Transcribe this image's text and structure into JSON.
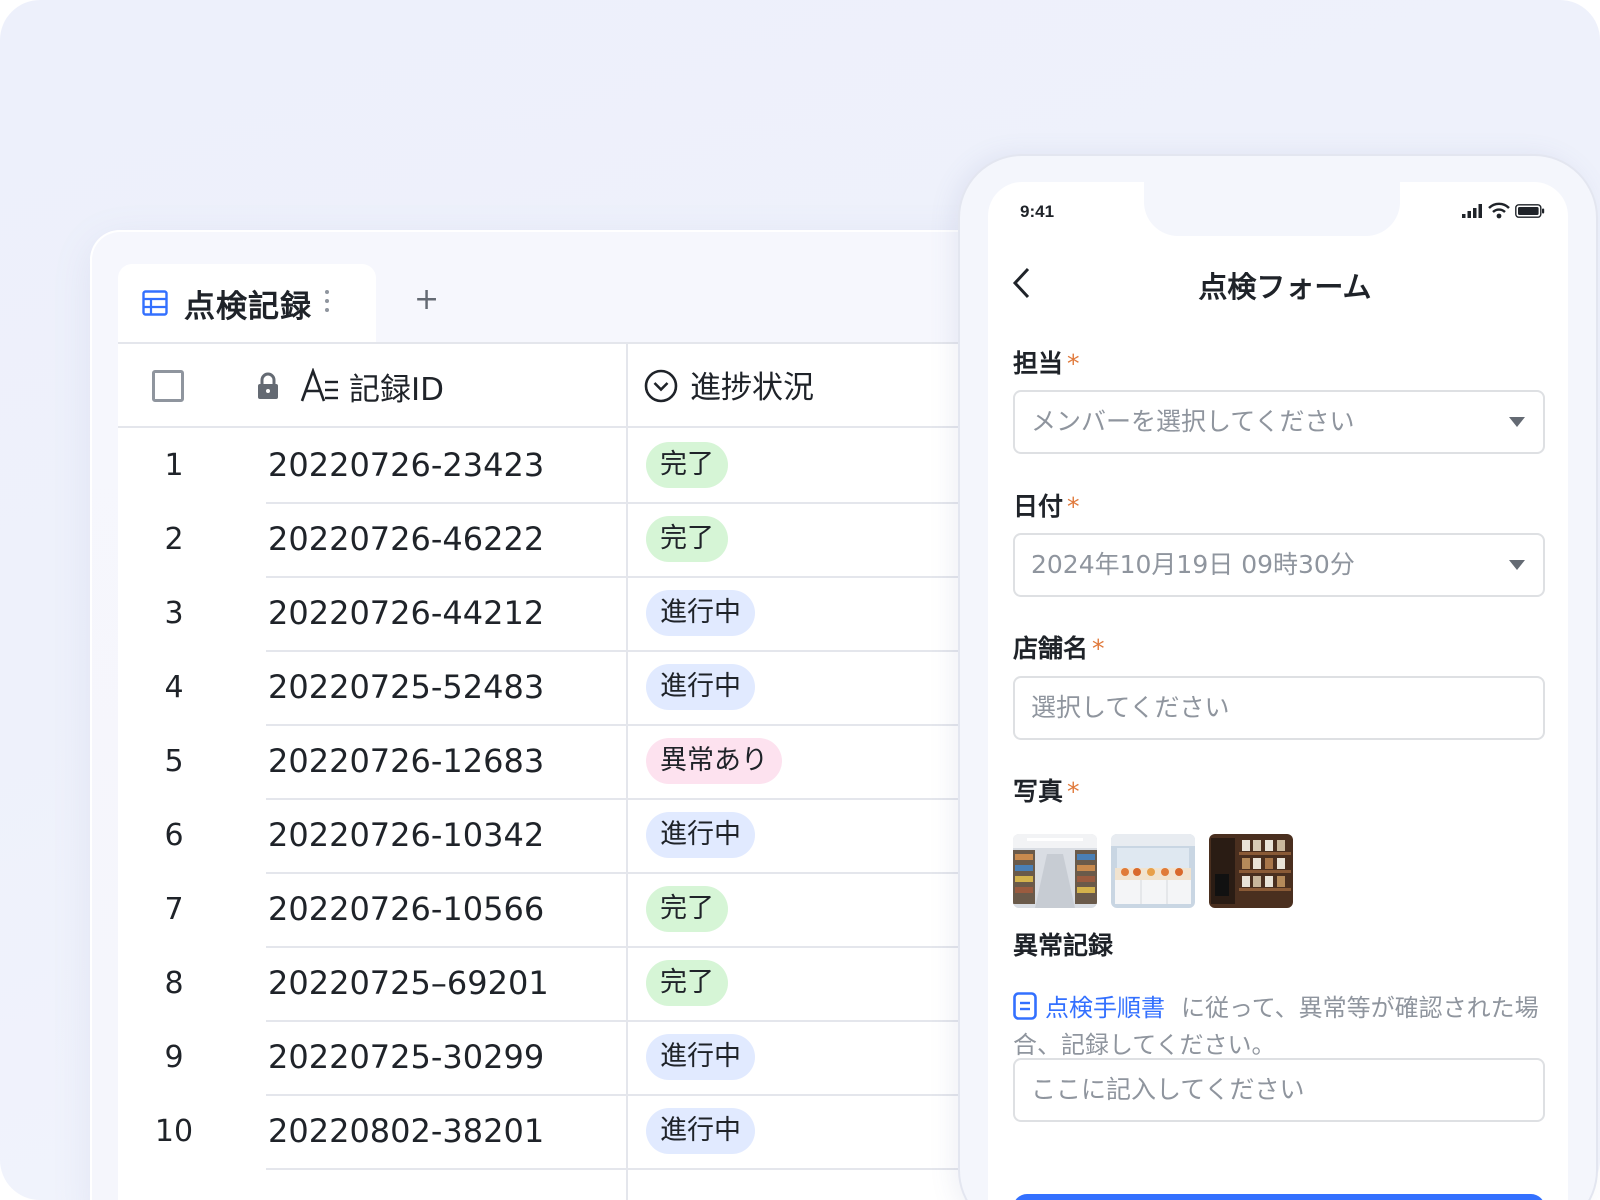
{
  "table": {
    "tab_label": "点検記録",
    "add_tab": "+",
    "headers": {
      "record_id": "記録ID",
      "status": "進捗状況"
    },
    "rows": [
      {
        "num": "1",
        "id": "20220726-23423",
        "status": "完了",
        "tone": "done"
      },
      {
        "num": "2",
        "id": "20220726-46222",
        "status": "完了",
        "tone": "done"
      },
      {
        "num": "3",
        "id": "20220726-44212",
        "status": "進行中",
        "tone": "progress"
      },
      {
        "num": "4",
        "id": "20220725-52483",
        "status": "進行中",
        "tone": "progress"
      },
      {
        "num": "5",
        "id": "20220726-12683",
        "status": "異常あり",
        "tone": "alert"
      },
      {
        "num": "6",
        "id": "20220726-10342",
        "status": "進行中",
        "tone": "progress"
      },
      {
        "num": "7",
        "id": "20220726-10566",
        "status": "完了",
        "tone": "done"
      },
      {
        "num": "8",
        "id": "20220725–69201",
        "status": "完了",
        "tone": "done"
      },
      {
        "num": "9",
        "id": "20220725-30299",
        "status": "進行中",
        "tone": "progress"
      },
      {
        "num": "10",
        "id": "20220802-38201",
        "status": "進行中",
        "tone": "progress"
      }
    ]
  },
  "status_colors": {
    "done": "#d6f5d6",
    "progress": "#e1eaff",
    "alert": "#fde2ef"
  },
  "phone": {
    "time": "9:41",
    "title": "点検フォーム",
    "fields": {
      "assignee": {
        "label": "担当",
        "required": "*",
        "placeholder": "メンバーを選択してください"
      },
      "date": {
        "label": "日付",
        "required": "*",
        "value": "2024年10月19日 09時30分"
      },
      "store": {
        "label": "店舗名",
        "required": "*",
        "placeholder": "選択してください"
      },
      "photos": {
        "label": "写真",
        "required": "*"
      },
      "anomaly": {
        "label": "異常記録",
        "link_text": "点検手順書",
        "note": "に従って、異常等が確認された場合、記録してください。",
        "placeholder": "ここに記入してください"
      }
    }
  },
  "colors": {
    "accent": "#3370ff",
    "required": "#e0793b"
  }
}
